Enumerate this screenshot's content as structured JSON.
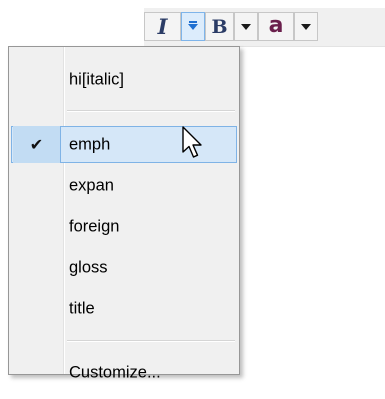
{
  "toolbar": {
    "italic_glyph": "I",
    "bold_glyph": "B",
    "text_color_glyph": "a",
    "italic_icon": "italic-icon",
    "bold_icon": "bold-icon",
    "color_icon": "font-color-icon",
    "active_accent": "#1f6fd1"
  },
  "menu": {
    "items": [
      {
        "label": "hi[italic]",
        "checked": false
      },
      {
        "label": "emph",
        "checked": true,
        "hovered": true
      },
      {
        "label": "expan",
        "checked": false
      },
      {
        "label": "foreign",
        "checked": false
      },
      {
        "label": "gloss",
        "checked": false
      },
      {
        "label": "title",
        "checked": false
      },
      {
        "label": "Customize...",
        "checked": false
      }
    ],
    "check_mark": "✔",
    "highlight_color": "#d5e7f8"
  },
  "cursor": {
    "icon": "mouse-pointer-icon"
  }
}
